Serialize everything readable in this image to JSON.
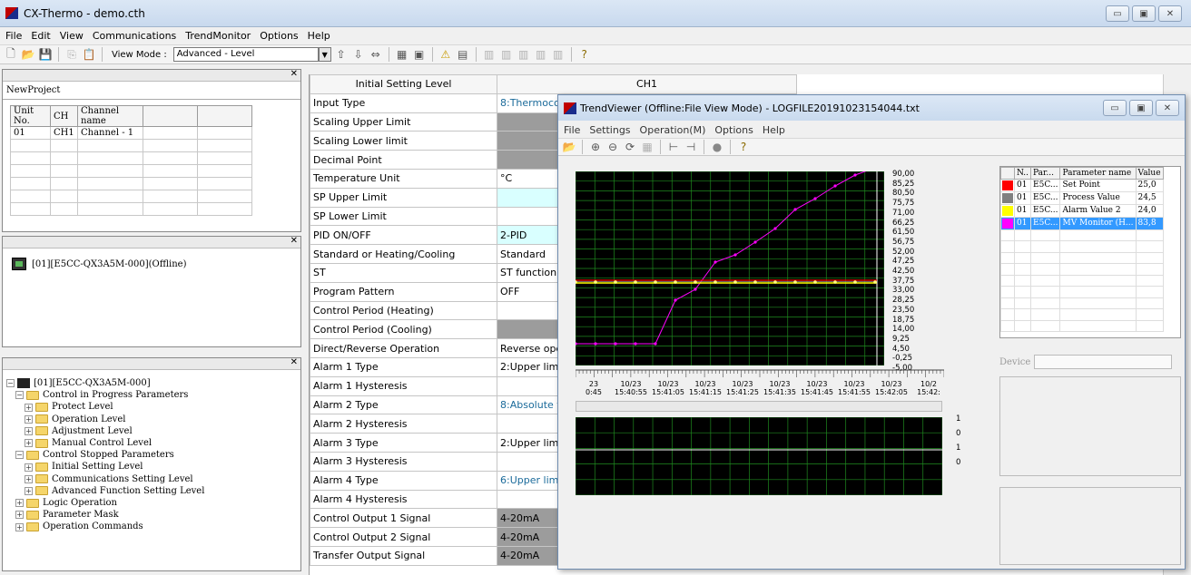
{
  "app": {
    "title": "CX-Thermo - demo.cth",
    "win_min": "▭",
    "win_max": "▣",
    "win_close": "✕"
  },
  "menu": [
    "File",
    "Edit",
    "View",
    "Communications",
    "TrendMonitor",
    "Options",
    "Help"
  ],
  "toolbar": {
    "view_mode_label": "View Mode :",
    "view_mode_value": "Advanced - Level"
  },
  "project": {
    "name": "NewProject",
    "columns": [
      "Unit No.",
      "CH",
      "Channel name"
    ],
    "rows": [
      [
        "01",
        "CH1",
        "Channel - 1"
      ]
    ]
  },
  "device": {
    "label": "[01][E5CC-QX3A5M-000](Offline)"
  },
  "tree": {
    "root": "[01][E5CC-QX3A5M-000]",
    "nodes": [
      {
        "label": "Control in Progress Parameters",
        "level": 1,
        "sign": "−"
      },
      {
        "label": "Protect Level",
        "level": 2,
        "sign": "+"
      },
      {
        "label": "Operation Level",
        "level": 2,
        "sign": "+"
      },
      {
        "label": "Adjustment Level",
        "level": 2,
        "sign": "+"
      },
      {
        "label": "Manual Control Level",
        "level": 2,
        "sign": "+"
      },
      {
        "label": "Control Stopped Parameters",
        "level": 1,
        "sign": "−"
      },
      {
        "label": "Initial Setting Level",
        "level": 2,
        "sign": "+"
      },
      {
        "label": "Communications Setting Level",
        "level": 2,
        "sign": "+"
      },
      {
        "label": "Advanced Function Setting Level",
        "level": 2,
        "sign": "+"
      },
      {
        "label": "Logic Operation",
        "level": 1,
        "sign": "+"
      },
      {
        "label": "Parameter Mask",
        "level": 1,
        "sign": "+"
      },
      {
        "label": "Operation Commands",
        "level": 1,
        "sign": "+"
      }
    ]
  },
  "grid": {
    "header": [
      "Initial Setting Level",
      "CH1"
    ],
    "rows": [
      {
        "param": "Input Type",
        "value": "8:Thermocou",
        "style": "cyanT"
      },
      {
        "param": "Scaling Upper Limit",
        "value": "",
        "style": "gray"
      },
      {
        "param": "Scaling Lower limit",
        "value": "",
        "style": "gray"
      },
      {
        "param": "Decimal Point",
        "value": "",
        "style": "gray"
      },
      {
        "param": "Temperature Unit",
        "value": "°C",
        "style": ""
      },
      {
        "param": "SP Upper Limit",
        "value": "",
        "style": "cyan"
      },
      {
        "param": "SP Lower Limit",
        "value": "",
        "style": ""
      },
      {
        "param": "PID ON/OFF",
        "value": "2-PID",
        "style": "cyan"
      },
      {
        "param": "Standard or Heating/Cooling",
        "value": "Standard",
        "style": ""
      },
      {
        "param": "ST",
        "value": "ST function O",
        "style": ""
      },
      {
        "param": "Program Pattern",
        "value": "OFF",
        "style": ""
      },
      {
        "param": "Control Period (Heating)",
        "value": "",
        "style": ""
      },
      {
        "param": "Control Period (Cooling)",
        "value": "",
        "style": "gray"
      },
      {
        "param": "Direct/Reverse Operation",
        "value": "Reverse ope",
        "style": ""
      },
      {
        "param": "Alarm 1 Type",
        "value": "2:Upper limi",
        "style": ""
      },
      {
        "param": "Alarm 1 Hysteresis",
        "value": "",
        "style": ""
      },
      {
        "param": "Alarm 2 Type",
        "value": "8:Absolute v",
        "style": "cyanT"
      },
      {
        "param": "Alarm 2 Hysteresis",
        "value": "",
        "style": ""
      },
      {
        "param": "Alarm 3 Type",
        "value": "2:Upper limi",
        "style": ""
      },
      {
        "param": "Alarm 3 Hysteresis",
        "value": "",
        "style": ""
      },
      {
        "param": "Alarm 4 Type",
        "value": "6:Upper limi",
        "style": "cyanT"
      },
      {
        "param": "Alarm 4 Hysteresis",
        "value": "",
        "style": ""
      },
      {
        "param": "Control Output 1 Signal",
        "value": "4-20mA",
        "style": "gray"
      },
      {
        "param": "Control Output 2 Signal",
        "value": "4-20mA",
        "style": "gray"
      },
      {
        "param": "Transfer Output Signal",
        "value": "4-20mA",
        "style": "gray"
      }
    ]
  },
  "trend": {
    "title": "TrendViewer (Offline:File View Mode) - LOGFILE20191023154044.txt",
    "menu": [
      "File",
      "Settings",
      "Operation(M)",
      "Options",
      "Help"
    ],
    "y_ticks": [
      "90,00",
      "85,25",
      "80,50",
      "75,75",
      "71,00",
      "66,25",
      "61,50",
      "56,75",
      "52,00",
      "47,25",
      "42,50",
      "37,75",
      "33,00",
      "28,25",
      "23,50",
      "18,75",
      "14,00",
      "9,25",
      "4,50",
      "-0,25",
      "-5,00"
    ],
    "x_ticks": [
      [
        "23",
        "0:45"
      ],
      [
        "10/23",
        "15:40:55"
      ],
      [
        "10/23",
        "15:41:05"
      ],
      [
        "10/23",
        "15:41:15"
      ],
      [
        "10/23",
        "15:41:25"
      ],
      [
        "10/23",
        "15:41:35"
      ],
      [
        "10/23",
        "15:41:45"
      ],
      [
        "10/23",
        "15:41:55"
      ],
      [
        "10/23",
        "15:42:05"
      ],
      [
        "10/2",
        "15:42:"
      ]
    ],
    "lower_ticks": [
      "1",
      "0",
      "1",
      "0"
    ],
    "params": {
      "columns": [
        "N..",
        "Par...",
        "Parameter name",
        "Value"
      ],
      "rows": [
        {
          "color": "#ff0000",
          "n": "01",
          "par": "E5C...",
          "name": "Set Point",
          "value": "25,0",
          "selected": false
        },
        {
          "color": "#808080",
          "n": "01",
          "par": "E5C...",
          "name": "Process Value",
          "value": "24,5",
          "selected": false
        },
        {
          "color": "#ffff00",
          "n": "01",
          "par": "E5C...",
          "name": "Alarm Value 2",
          "value": "24,0",
          "selected": false
        },
        {
          "color": "#ff00ff",
          "n": "01",
          "par": "E5C...",
          "name": "MV Monitor (H...",
          "value": "83,8",
          "selected": true
        }
      ]
    },
    "device_label": "Device"
  }
}
